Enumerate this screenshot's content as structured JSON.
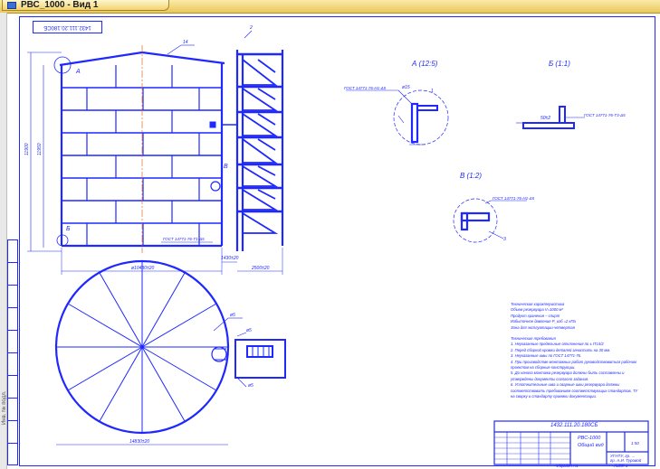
{
  "window": {
    "tab_title": "РВС_1000 - Вид 1"
  },
  "sheet": {
    "stamp_text": "1432.111.20.180СБ",
    "side_ruler_text": "Инв. № подл."
  },
  "drawing": {
    "view_labels": {
      "view_a": "А (12:5)",
      "view_b": "Б (1:1)",
      "view_v": "В (1:2)",
      "callout_a": "А",
      "callout_b": "Б",
      "callout_v": "В"
    },
    "weld_notes": {
      "a": "ГОСТ 14771-76-Н1-Δ5",
      "b": "ГОСТ 14771-76-Т3-Δ5",
      "v": "ГОСТ 14771-76-Н1-Δ5",
      "main": "ГОСТ 14771-76-Т1-Δ5"
    },
    "dimensions": {
      "height_overall": "11900",
      "height_shell": "11950",
      "diameter_main": "ø10430±20",
      "stair_offset": "1430±20",
      "stair_width": "2500±20",
      "plan_diameter": "14830±20",
      "detail_a1": "ø15",
      "detail_b1": "50±2",
      "leader_14": "14",
      "leader_2": "2",
      "leader_1": "1",
      "leader_3": "3"
    },
    "plan_labels": {
      "p1": "ø5",
      "p2": "ø5",
      "p3": "ø5"
    }
  },
  "notes": {
    "title1": "Техническая характеристика",
    "spec": [
      "Объем резервуара V=1000 м³",
      "Продукт хранения – спирт",
      "Избыточное давление Р_изб =2 кПа",
      "Зона для эксплуатации-четвертая"
    ],
    "title2": "Технические требования",
    "reqs": [
      "1. Неуказанные предельные отклонения по ± IT14/2",
      "2. Перед сборкой кромки деталей зачистить на 30 мм.",
      "3. Неуказанные швы по ГОСТ 14771-76.",
      "4. При производстве монтажных работ руководствоваться рабочим",
      "   проектом на сборные конструкции.",
      "5. До начала монтажа резервуара должны быть составлены и",
      "   утверждены документы согласно задания.",
      "6. Уплотнительные шва и сварные швы резервуара должны",
      "   соответствовать требованиям соответствующих стандартов, ТУ",
      "   на сварку и стандарту приемки документации."
    ]
  },
  "title_block": {
    "code": "1432.111.20.180СБ",
    "name": "РВС-1000",
    "subname": "Общий вид",
    "mass": "1:50",
    "org1": "УГНТУ, гр. ...",
    "org2": "гр. А.И. Туровой",
    "sheet_label": "Лист 1",
    "format": "Формат А1"
  }
}
